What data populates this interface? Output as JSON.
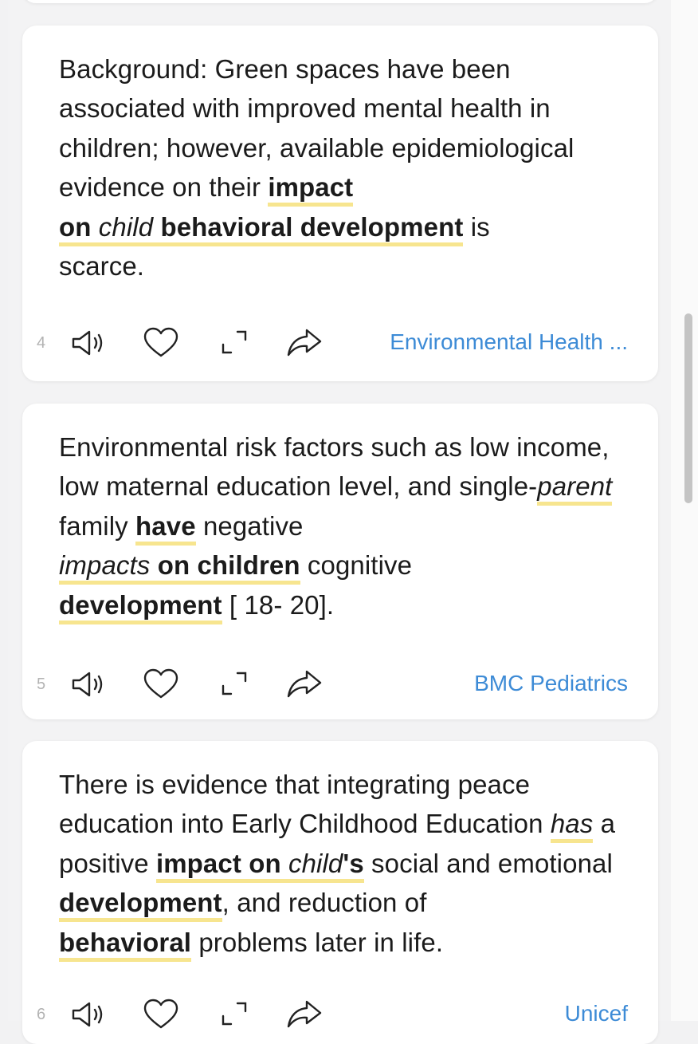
{
  "cards": [
    {
      "number": "4",
      "segments": [
        "Background: Green spaces have been associated with improved mental health in children; however, available epidemiological evidence on their ",
        "impact",
        "on",
        "child",
        "behavioral development",
        " is ",
        "scarce."
      ],
      "source": "Environmental Health ..."
    },
    {
      "number": "5",
      "segments": [
        "Environmental risk factors such as low income, low maternal education level, and single-",
        "parent",
        " family ",
        "have",
        " negative ",
        "impacts",
        "on children",
        " cognitive ",
        "development",
        " [ 18- 20]."
      ],
      "source": "BMC Pediatrics"
    },
    {
      "number": "6",
      "segments": [
        "There is evidence that integrating peace education into Early Childhood Education ",
        "has",
        " a positive ",
        "impact on",
        "child",
        "'s",
        " social and emotional ",
        "development",
        ", and reduction of ",
        "behavioral",
        " problems later in life."
      ],
      "source": "Unicef"
    }
  ],
  "icons": [
    "speaker-icon",
    "heart-icon",
    "expand-icon",
    "share-icon"
  ],
  "colors": {
    "highlight": "#f7e58f",
    "link": "#3d8bd6",
    "background": "#f3f3f4",
    "card": "#ffffff"
  }
}
